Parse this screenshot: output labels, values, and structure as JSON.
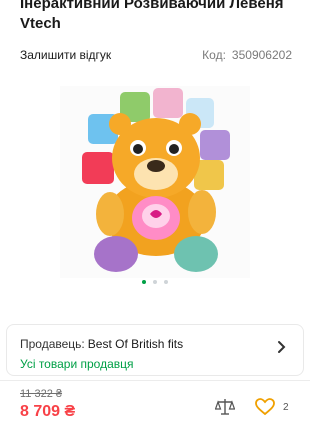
{
  "product": {
    "title": "Інерактивний Розвиваючий Левеня Vtech",
    "review_link": "Залишити відгук",
    "code_label": "Код:",
    "code_value": "350906202"
  },
  "gallery": {
    "dots_total": 3,
    "active_dot": 1
  },
  "seller": {
    "label": "Продавець:",
    "name": "Best Of British fits",
    "all_products": "Усі товари продавця"
  },
  "pricing": {
    "old_price": "11 322 ₴",
    "price": "8 709 ₴",
    "likes": "2"
  },
  "colors": {
    "accent": "#00a046",
    "price": "#f84147"
  }
}
